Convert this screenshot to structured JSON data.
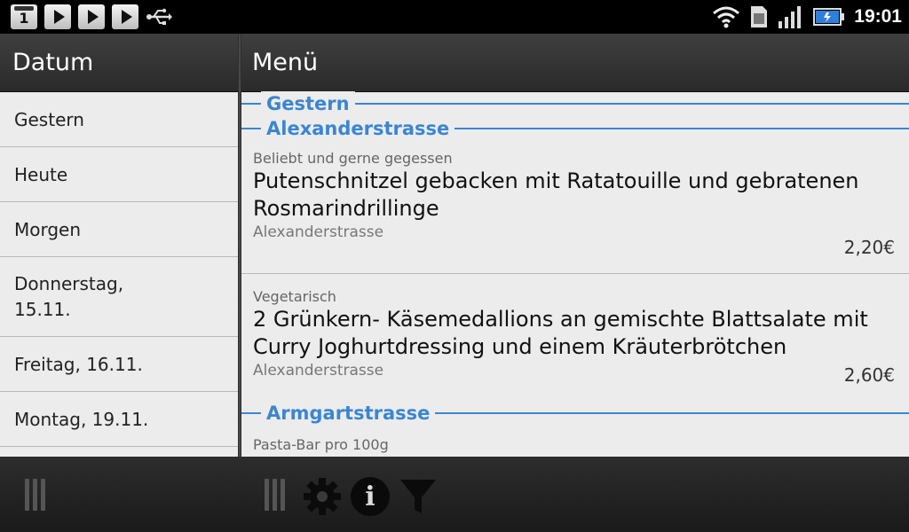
{
  "status_bar": {
    "time": "19:01",
    "calendar_day": "1",
    "icons": [
      "calendar-icon",
      "play-store-icon",
      "play-store-icon",
      "play-store-icon",
      "usb-icon",
      "wifi-icon",
      "sim-icon",
      "signal-icon",
      "battery-icon"
    ]
  },
  "left_panel": {
    "title": "Datum",
    "items": [
      {
        "label": "Gestern"
      },
      {
        "label": "Heute"
      },
      {
        "label": "Morgen"
      },
      {
        "label": "Donnerstag, 15.11."
      },
      {
        "label": "Freitag, 16.11."
      },
      {
        "label": "Montag, 19.11."
      }
    ]
  },
  "right_panel": {
    "title": "Menü",
    "sections": [
      {
        "label": "Gestern"
      },
      {
        "label": "Alexanderstrasse"
      },
      {
        "label": "Armgartstrasse"
      }
    ],
    "meals": [
      {
        "category": "Beliebt und gerne gegessen",
        "title": "Putenschnitzel gebacken mit Ratatouille und gebratenen Rosmarindrillinge",
        "location": "Alexanderstrasse",
        "price": "2,20€"
      },
      {
        "category": "Vegetarisch",
        "title": "2 Grünkern- Käsemedallions an gemischte Blattsalate mit Curry Joghurtdressing und einem Kräuterbrötchen",
        "location": "Alexanderstrasse",
        "price": "2,60€"
      },
      {
        "category": "Pasta-Bar pro 100g"
      }
    ]
  },
  "bottom_bar": {
    "icons": [
      "settings-icon",
      "info-icon",
      "filter-icon"
    ],
    "info_glyph": "i"
  },
  "colors": {
    "accent": "#3b86d1",
    "header_bg": "#333333",
    "list_bg": "#ececec"
  }
}
